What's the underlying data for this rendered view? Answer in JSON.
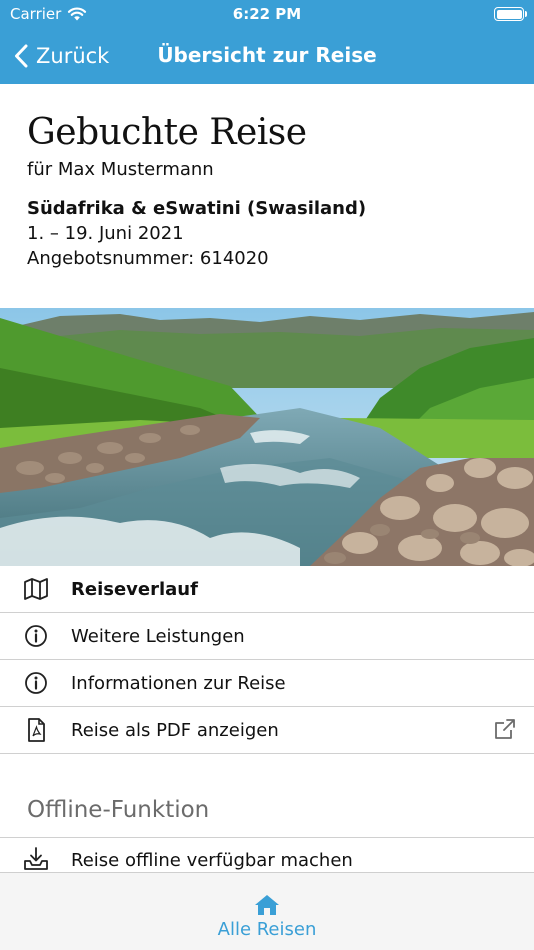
{
  "status_bar": {
    "carrier": "Carrier",
    "time": "6:22 PM"
  },
  "nav": {
    "back_label": "Zurück",
    "title": "Übersicht zur Reise"
  },
  "header": {
    "title": "Gebuchte Reise",
    "for_line": "für Max Mustermann",
    "trip_name": "Südafrika & eSwatini (Swasiland)",
    "dates": "1.  – 19. Juni 2021",
    "offer_number": "Angebotsnummer: 614020"
  },
  "menu": {
    "items": [
      {
        "label": "Reiseverlauf",
        "icon": "map-icon"
      },
      {
        "label": "Weitere Leistungen",
        "icon": "info-icon"
      },
      {
        "label": "Informationen zur Reise",
        "icon": "info-icon"
      },
      {
        "label": "Reise als PDF anzeigen",
        "icon": "pdf-file-icon",
        "trailing_icon": "external-link-icon"
      }
    ]
  },
  "offline": {
    "section_title": "Offline-Funktion",
    "item_label": "Reise offline verfügbar machen",
    "item_icon": "download-tray-icon"
  },
  "tabbar": {
    "label": "Alle Reisen",
    "icon": "home-icon"
  },
  "colors": {
    "accent": "#3a9fd6",
    "tabbar_bg": "#f5f5f5",
    "separator": "#d0d0d0",
    "section_title": "#6b6b6b"
  }
}
